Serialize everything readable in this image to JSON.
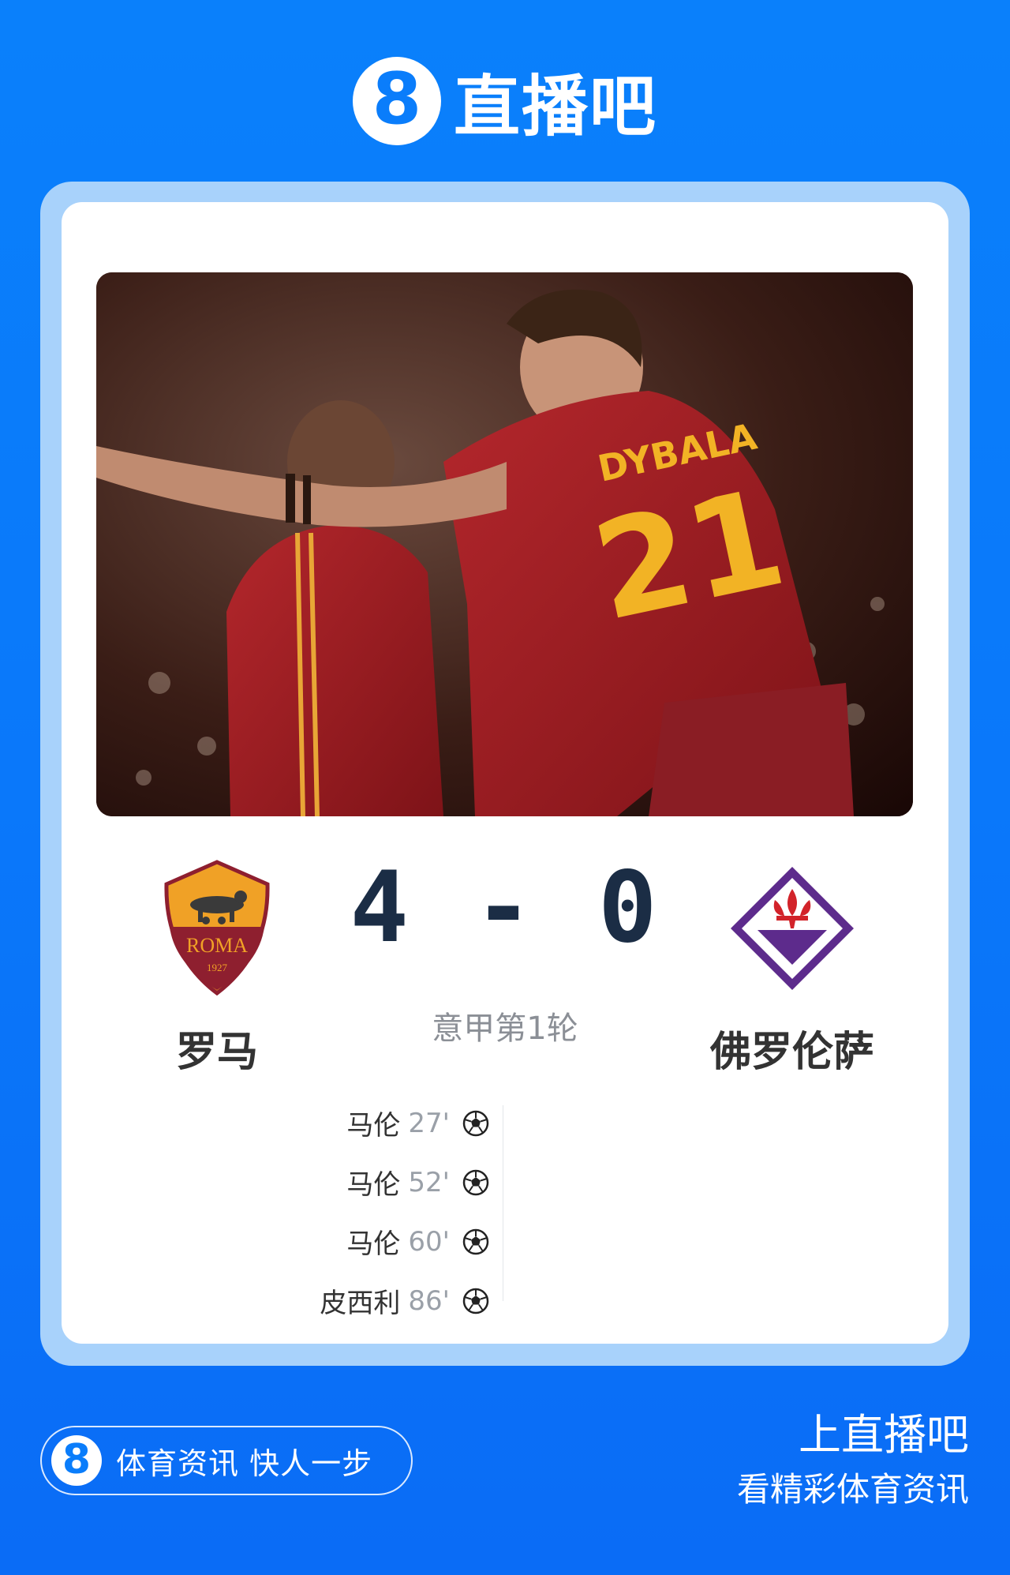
{
  "brand": {
    "logo_char": "8",
    "name": "直播吧"
  },
  "match": {
    "home_team": {
      "name": "罗马",
      "crest_text": "ROMA",
      "crest_year": "1927",
      "crest_icon": "as-roma-crest-icon"
    },
    "away_team": {
      "name": "佛罗伦萨",
      "crest_icon": "fiorentina-crest-icon"
    },
    "score": "4 - 0",
    "round": "意甲第1轮",
    "photo": {
      "jersey_name": "DYBALA",
      "jersey_number": "21"
    },
    "home_goals": [
      {
        "player": "马伦",
        "minute": "27'"
      },
      {
        "player": "马伦",
        "minute": "52'"
      },
      {
        "player": "马伦",
        "minute": "60'"
      },
      {
        "player": "皮西利",
        "minute": "86'"
      }
    ],
    "goal_icon": "soccer-ball-icon"
  },
  "footer": {
    "slogan": "体育资讯 快人一步",
    "cta_line1": "上直播吧",
    "cta_line2": "看精彩体育资讯"
  },
  "colors": {
    "background": "#0a78fa",
    "card_border": "#a8d2fb",
    "score": "#1b2d45",
    "roma_red": "#8e1f2f",
    "roma_gold": "#f0a126",
    "fiorentina_purple": "#5d2b8c"
  }
}
